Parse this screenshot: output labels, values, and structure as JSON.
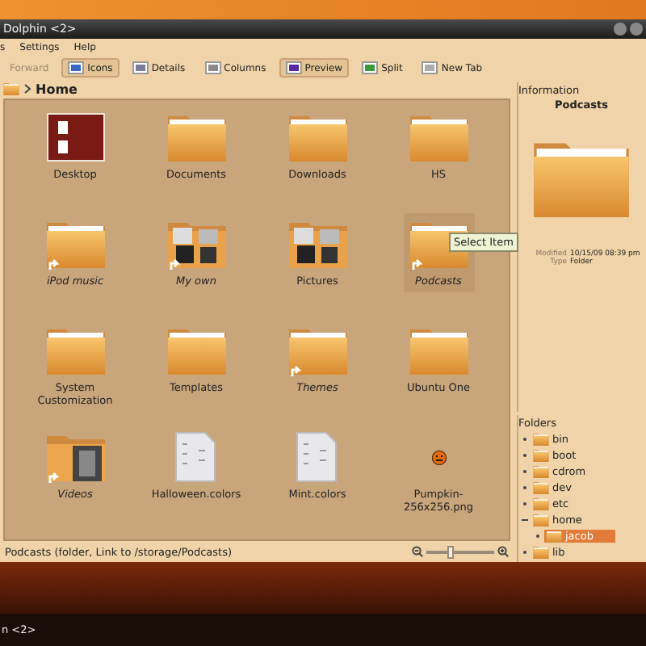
{
  "window": {
    "title": "Dolphin <2>"
  },
  "menu": [
    "s",
    "Settings",
    "Help"
  ],
  "toolbar": [
    {
      "label": "Forward",
      "kind": "plain",
      "disabled": true,
      "selected": false
    },
    {
      "label": "Icons",
      "kind": "icons",
      "disabled": false,
      "selected": true
    },
    {
      "label": "Details",
      "kind": "details",
      "disabled": false,
      "selected": false
    },
    {
      "label": "Columns",
      "kind": "columns",
      "disabled": false,
      "selected": false
    },
    {
      "label": "Preview",
      "kind": "preview",
      "disabled": false,
      "selected": true
    },
    {
      "label": "Split",
      "kind": "split",
      "disabled": false,
      "selected": false
    },
    {
      "label": "New Tab",
      "kind": "newtab",
      "disabled": false,
      "selected": false
    }
  ],
  "breadcrumb": "Home",
  "items": [
    {
      "name": "Desktop",
      "kind": "desktop",
      "link": false,
      "selected": false
    },
    {
      "name": "Documents",
      "kind": "folder",
      "link": false,
      "selected": false
    },
    {
      "name": "Downloads",
      "kind": "folder",
      "link": false,
      "selected": false
    },
    {
      "name": "HS",
      "kind": "folder",
      "link": false,
      "selected": false
    },
    {
      "name": "iPod music",
      "kind": "folder",
      "link": true,
      "selected": false
    },
    {
      "name": "My own",
      "kind": "photos",
      "link": true,
      "selected": false
    },
    {
      "name": "Pictures",
      "kind": "photos",
      "link": false,
      "selected": false
    },
    {
      "name": "Podcasts",
      "kind": "folder",
      "link": true,
      "selected": true,
      "tooltip": "Select Item"
    },
    {
      "name": "System Customization",
      "kind": "folder",
      "link": false,
      "selected": false
    },
    {
      "name": "Templates",
      "kind": "folder",
      "link": false,
      "selected": false
    },
    {
      "name": "Themes",
      "kind": "folder",
      "link": true,
      "selected": false
    },
    {
      "name": "Ubuntu One",
      "kind": "folder",
      "link": false,
      "selected": false
    },
    {
      "name": "Videos",
      "kind": "video",
      "link": true,
      "selected": false
    },
    {
      "name": "Halloween.colors",
      "kind": "text",
      "link": false,
      "selected": false
    },
    {
      "name": "Mint.colors",
      "kind": "text",
      "link": false,
      "selected": false
    },
    {
      "name": "Pumpkin-256x256.png",
      "kind": "pumpkin",
      "link": false,
      "selected": false
    }
  ],
  "status": {
    "text": "Podcasts (folder, Link to /storage/Podcasts)",
    "zoom": {
      "level": 0.35
    }
  },
  "information": {
    "title": "Information",
    "name": "Podcasts",
    "fields": [
      {
        "label": "Modified",
        "value": "10/15/09 08:39 pm"
      },
      {
        "label": "Type",
        "value": "Folder"
      }
    ]
  },
  "folders": {
    "title": "Folders",
    "tree": [
      {
        "name": "bin",
        "selected": false,
        "expanded": false
      },
      {
        "name": "boot",
        "selected": false,
        "expanded": false
      },
      {
        "name": "cdrom",
        "selected": false,
        "expanded": false
      },
      {
        "name": "dev",
        "selected": false,
        "expanded": false
      },
      {
        "name": "etc",
        "selected": false,
        "expanded": false
      },
      {
        "name": "home",
        "selected": false,
        "expanded": true,
        "children": [
          {
            "name": "jacob",
            "selected": true,
            "expanded": false
          }
        ]
      },
      {
        "name": "lib",
        "selected": false,
        "expanded": false
      }
    ]
  },
  "taskbar": {
    "label": "n <2>"
  }
}
